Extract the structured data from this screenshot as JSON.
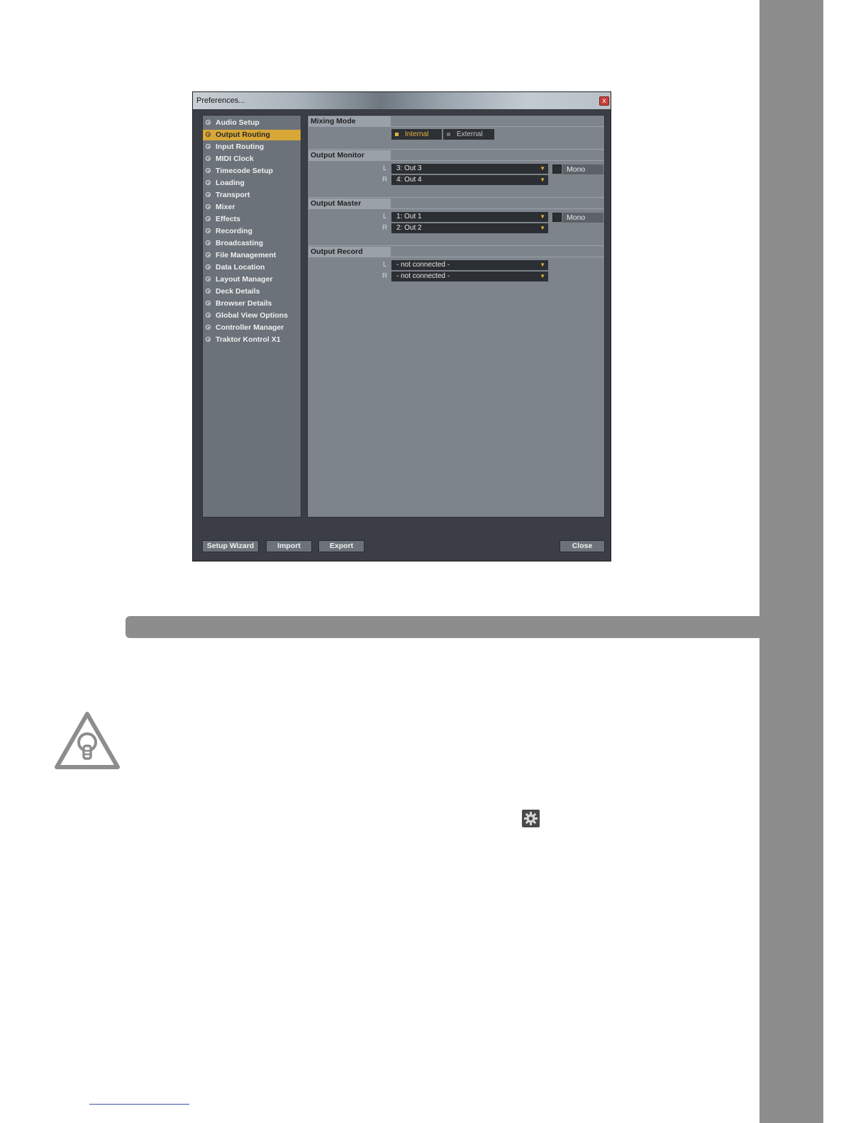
{
  "window": {
    "title": "Preferences...",
    "close_glyph": "x"
  },
  "sidebar": {
    "items": [
      {
        "label": "Audio Setup"
      },
      {
        "label": "Output Routing",
        "active": true
      },
      {
        "label": "Input Routing"
      },
      {
        "label": "MIDI Clock"
      },
      {
        "label": "Timecode Setup"
      },
      {
        "label": "Loading"
      },
      {
        "label": "Transport"
      },
      {
        "label": "Mixer"
      },
      {
        "label": "Effects"
      },
      {
        "label": "Recording"
      },
      {
        "label": "Broadcasting"
      },
      {
        "label": "File Management"
      },
      {
        "label": "Data Location"
      },
      {
        "label": "Layout Manager"
      },
      {
        "label": "Deck Details"
      },
      {
        "label": "Browser Details"
      },
      {
        "label": "Global View Options"
      },
      {
        "label": "Controller Manager"
      },
      {
        "label": "Traktor Kontrol X1"
      }
    ]
  },
  "mixing_mode": {
    "header": "Mixing Mode",
    "internal": "Internal",
    "external": "External",
    "selected": "Internal"
  },
  "output_monitor": {
    "header": "Output Monitor",
    "left_label": "L",
    "left_value": "3: Out 3",
    "right_label": "R",
    "right_value": "4: Out 4",
    "mono_label": "Mono"
  },
  "output_master": {
    "header": "Output Master",
    "left_label": "L",
    "left_value": "1: Out 1",
    "right_label": "R",
    "right_value": "2: Out 2",
    "mono_label": "Mono"
  },
  "output_record": {
    "header": "Output Record",
    "left_label": "L",
    "left_value": "- not connected -",
    "right_label": "R",
    "right_value": "- not connected -"
  },
  "buttons": {
    "setup_wizard": "Setup Wizard",
    "import": "Import",
    "export": "Export",
    "close": "Close"
  },
  "colors": {
    "accent": "#d8a737",
    "side_strip": "#8e8d8e"
  },
  "icons": {
    "tip": "lightbulb-warning-icon",
    "settings": "gear-icon"
  }
}
